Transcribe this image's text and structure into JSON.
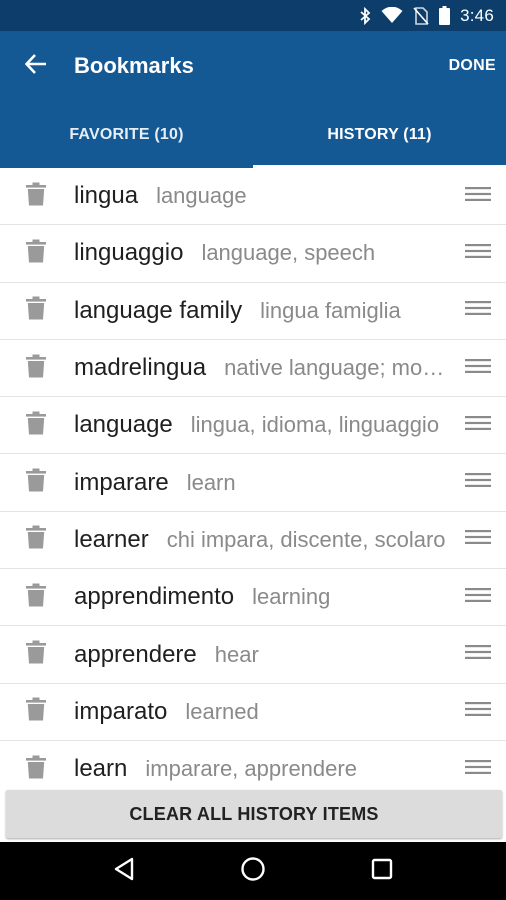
{
  "status_bar": {
    "time": "3:46"
  },
  "app_bar": {
    "title": "Bookmarks",
    "done_label": "DONE"
  },
  "tabs": [
    {
      "label": "FAVORITE (10)",
      "active": false
    },
    {
      "label": "HISTORY (11)",
      "active": true
    }
  ],
  "history": [
    {
      "word": "lingua",
      "meaning": "language"
    },
    {
      "word": "linguaggio",
      "meaning": "language, speech"
    },
    {
      "word": "language family",
      "meaning": "lingua famiglia"
    },
    {
      "word": "madrelingua",
      "meaning": "native language; mother tongue"
    },
    {
      "word": "language",
      "meaning": "lingua, idioma, linguaggio"
    },
    {
      "word": "imparare",
      "meaning": "learn"
    },
    {
      "word": "learner",
      "meaning": "chi impara, discente, scolaro"
    },
    {
      "word": "apprendimento",
      "meaning": "learning"
    },
    {
      "word": "apprendere",
      "meaning": "hear"
    },
    {
      "word": "imparato",
      "meaning": "learned"
    },
    {
      "word": "learn",
      "meaning": "imparare, apprendere"
    }
  ],
  "clear_button_label": "CLEAR ALL HISTORY ITEMS",
  "colors": {
    "app_bar": "#145894",
    "status_bar": "#0c3d6b",
    "nav_bar": "#000000"
  },
  "icons": [
    "bluetooth-icon",
    "wifi-icon",
    "no-sim-icon",
    "battery-icon",
    "back-arrow-icon",
    "trash-icon",
    "drag-handle-icon",
    "nav-back-icon",
    "nav-home-icon",
    "nav-recents-icon"
  ]
}
